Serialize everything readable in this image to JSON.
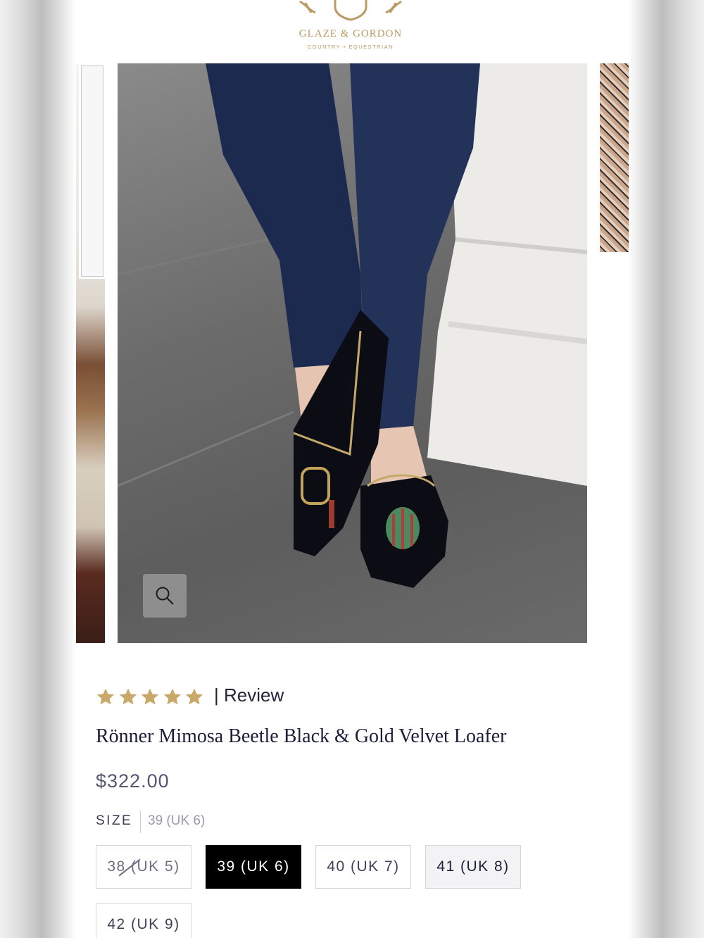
{
  "header": {
    "brand_name": "GLAZE & GORDON",
    "brand_tagline": "COUNTRY • EQUESTRIAN"
  },
  "gallery": {
    "zoom_icon": "search-icon"
  },
  "product": {
    "rating": {
      "stars": 5,
      "max": 5,
      "color": "#c9a86a"
    },
    "review_label": "| Review",
    "title": "Rönner Mimosa Beetle Black & Gold Velvet Loafer",
    "price": "$322.00",
    "size": {
      "label": "SIZE",
      "selected_value": "39 (UK 6)",
      "options": [
        {
          "label": "38 (UK 5)",
          "state": "unavailable"
        },
        {
          "label": "39 (UK 6)",
          "state": "selected"
        },
        {
          "label": "40 (UK 7)",
          "state": "available"
        },
        {
          "label": "41 (UK 8)",
          "state": "hover"
        },
        {
          "label": "42 (UK 9)",
          "state": "available"
        }
      ]
    }
  },
  "colors": {
    "brand_gold": "#bb9a63",
    "text_navy": "#1c1f3a",
    "selected_bg": "#000000"
  }
}
